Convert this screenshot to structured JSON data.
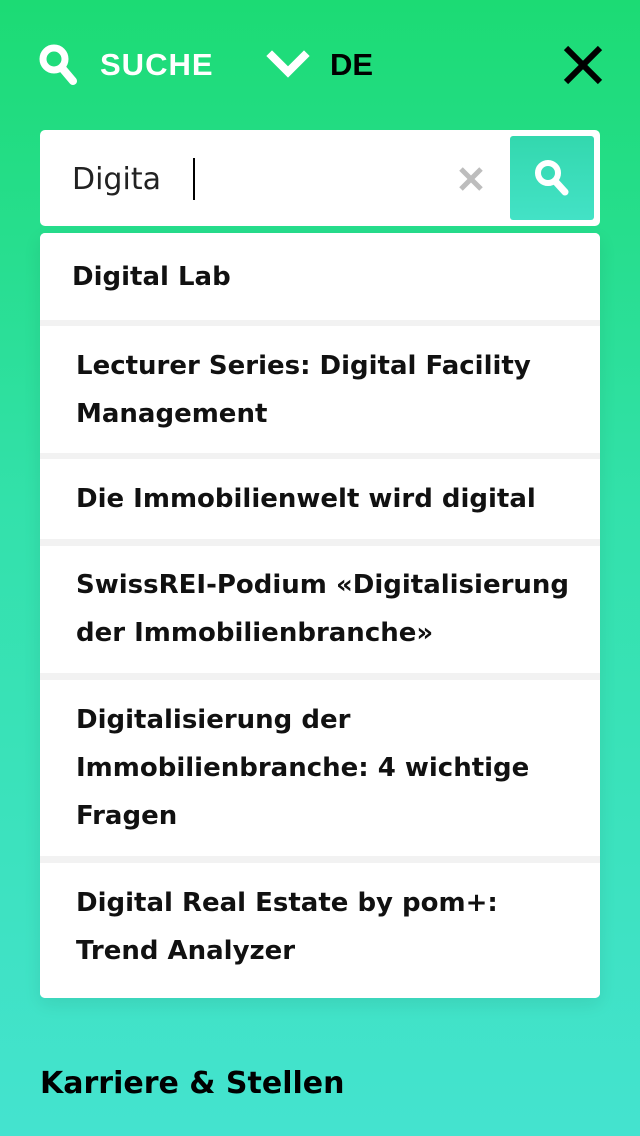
{
  "header": {
    "search_label": "SUCHE",
    "language_label": "DE"
  },
  "search": {
    "value": "Digita",
    "placeholder": ""
  },
  "suggestions": [
    {
      "label": "Digital Lab"
    },
    {
      "label": "Lecturer Series: Digital Facility Management"
    },
    {
      "label": "Die Immobilienwelt wird digital"
    },
    {
      "label": "SwissREI-Podium «Digitalisierung der Immobilienbranche»"
    },
    {
      "label": "Digitalisierung der Immobilienbranche: 4 wichtige Fragen"
    },
    {
      "label": "Digital Real Estate by pom+: Trend Analyzer"
    }
  ],
  "footer": {
    "career_link": "Karriere & Stellen"
  },
  "colors": {
    "background_top": "#1cdb74",
    "background_bottom": "#44e3cf",
    "submit_button": "#3adbb8",
    "clear_icon": "#bdbdbd"
  },
  "icons": {
    "search_toggle": "search-icon",
    "language_toggle": "chevron-down-icon",
    "close": "close-icon",
    "clear": "clear-icon",
    "submit": "search-icon"
  }
}
